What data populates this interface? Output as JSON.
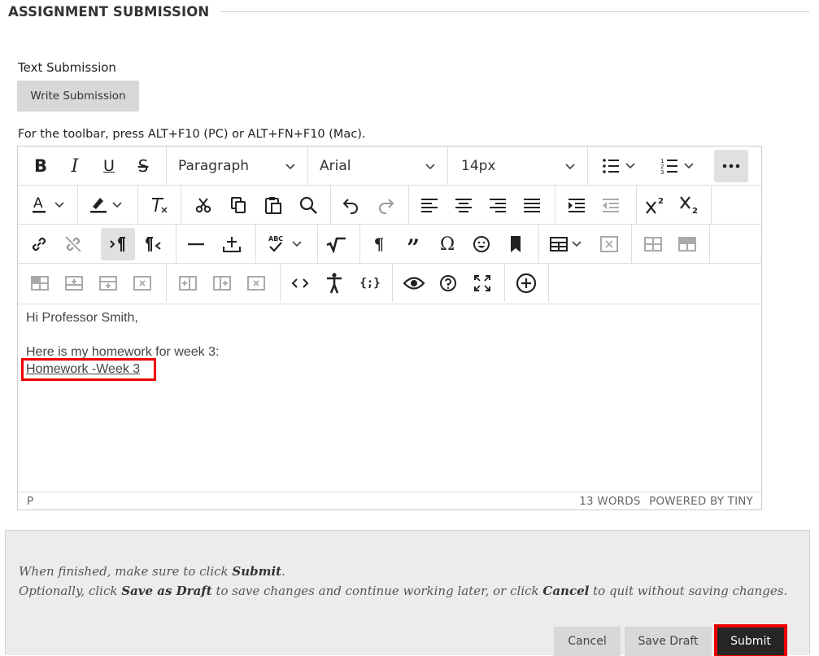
{
  "section": {
    "title": "ASSIGNMENT SUBMISSION"
  },
  "text_submission": {
    "label": "Text Submission",
    "write_button": "Write Submission"
  },
  "toolbar_hint": "For the toolbar, press ALT+F10 (PC) or ALT+FN+F10 (Mac).",
  "editor": {
    "block_format": "Paragraph",
    "font_family": "Arial",
    "font_size": "14px",
    "content": {
      "line1": "Hi Professor Smith,",
      "line2": "Here is my homework for week 3:",
      "link_text": "Homework -Week 3"
    },
    "status": {
      "path": "P",
      "word_count": "13 WORDS",
      "powered_by": "POWERED BY TINY"
    }
  },
  "footer": {
    "line1_prefix": "When finished, make sure to click ",
    "line1_bold": "Submit",
    "line1_suffix": ".",
    "line2_prefix": "Optionally, click ",
    "line2_bold1": "Save as Draft",
    "line2_mid": " to save changes and continue working later, or click ",
    "line2_bold2": "Cancel",
    "line2_suffix": " to quit without saving changes.",
    "cancel": "Cancel",
    "save_draft": "Save Draft",
    "submit": "Submit"
  },
  "colors": {
    "highlight_red": "#e00000",
    "submit_bg": "#262626",
    "toolbar_active": "#dee0e2"
  }
}
